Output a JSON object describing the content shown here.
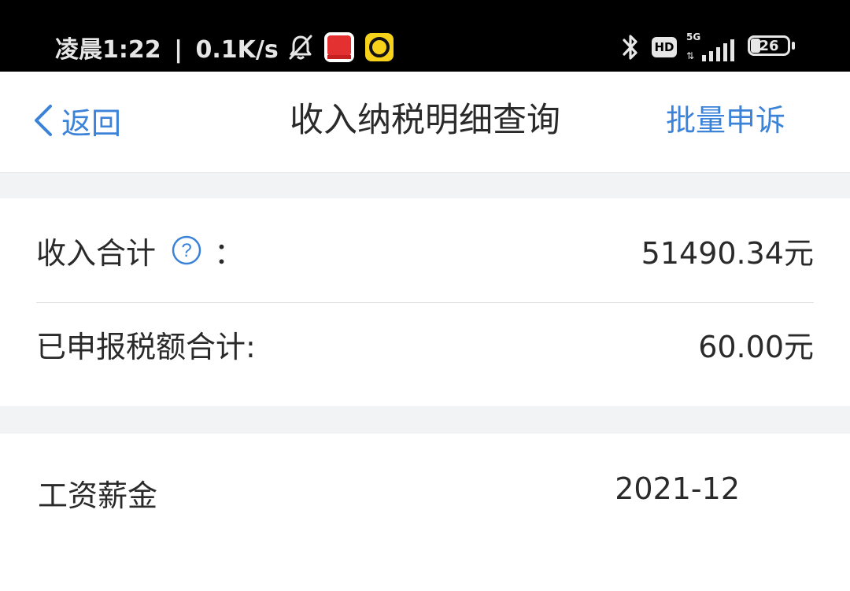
{
  "status_bar": {
    "time": "凌晨1:22",
    "separator": "|",
    "speed": "0.1K/s",
    "icons": [
      "bell-muted-icon",
      "app-icon-red",
      "app-icon-yellow",
      "bluetooth-icon",
      "hd-icon",
      "5g-signal-icon",
      "battery-icon"
    ],
    "hd": "HD",
    "network": "5G",
    "battery": "26"
  },
  "nav": {
    "back_label": "返回",
    "title": "收入纳税明细查询",
    "batch_label": "批量申诉"
  },
  "summary": {
    "income_label": "收入合计",
    "income_colon": "：",
    "income_value": "51490.34元",
    "tax_label": "已申报税额合计:",
    "tax_value": "60.00元"
  },
  "detail": {
    "item_label": "工资薪金",
    "item_date": "2021-12"
  },
  "colors": {
    "accent": "#3b83d8",
    "text": "#2a2a2a",
    "background": "#f2f3f5"
  }
}
